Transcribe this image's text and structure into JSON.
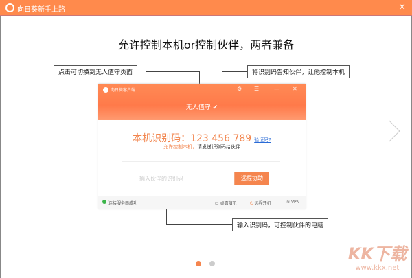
{
  "window": {
    "title": "向日葵新手上路",
    "close_icon": "×"
  },
  "headline": "允许控制本机or控制伙伴，两者兼备",
  "callouts": {
    "left": "点击可切换到无人值守页面",
    "right": "将识别码告知伙伴，让他控制本机",
    "bottom": "输入识别码，可控制伙伴的电脑"
  },
  "app": {
    "title": "向日葵客户端",
    "mode": "无人值守",
    "code_label": "本机识别码：",
    "code": "123 456 789",
    "verify_link": "验证码?",
    "sub_orange": "允许控制本机，",
    "sub_text": "请发送识别码给伙伴",
    "input_placeholder": "输入伙伴的识别码",
    "remote_button": "远程协助",
    "status": "连接服务器成功",
    "footer": [
      "桌面演示",
      "远程开机",
      "VPN"
    ]
  },
  "pagination": {
    "current": 1,
    "total": 2
  },
  "watermark": {
    "logo": "KK下载",
    "url": "www.kkx.net"
  },
  "colors": {
    "accent": "#ff8a4c",
    "link": "#2a6bd6"
  }
}
